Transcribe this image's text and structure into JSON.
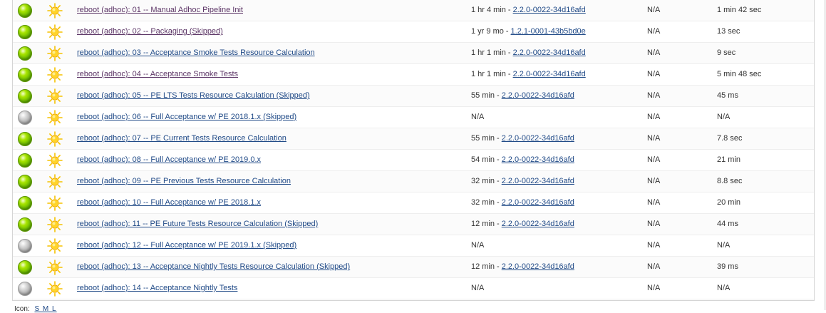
{
  "jobs": [
    {
      "status": "blue",
      "weather": "sunny-icon",
      "name": "reboot (adhoc): 01 -- Manual Adhoc Pipeline Init",
      "visited": true,
      "last_success_time": "1 hr 4 min",
      "last_success_build": "2.2.0-0022-34d16afd",
      "last_failure": "N/A",
      "last_duration": "1 min 42 sec"
    },
    {
      "status": "blue",
      "weather": "sunny-icon",
      "name": "reboot (adhoc): 02 -- Packaging (Skipped)",
      "visited": true,
      "last_success_time": "1 yr 9 mo",
      "last_success_build": "1.2.1-0001-43b5bd0e",
      "last_failure": "N/A",
      "last_duration": "13 sec"
    },
    {
      "status": "blue",
      "weather": "sunny-icon",
      "name": "reboot (adhoc): 03 -- Acceptance Smoke Tests Resource Calculation",
      "visited": false,
      "last_success_time": "1 hr 1 min",
      "last_success_build": "2.2.0-0022-34d16afd",
      "last_failure": "N/A",
      "last_duration": "9 sec"
    },
    {
      "status": "blue",
      "weather": "sunny-icon",
      "name": "reboot (adhoc): 04 -- Acceptance Smoke Tests",
      "visited": true,
      "last_success_time": "1 hr 1 min",
      "last_success_build": "2.2.0-0022-34d16afd",
      "last_failure": "N/A",
      "last_duration": "5 min 48 sec"
    },
    {
      "status": "blue",
      "weather": "sunny-icon",
      "name": "reboot (adhoc): 05 -- PE LTS Tests Resource Calculation (Skipped)",
      "visited": false,
      "last_success_time": "55 min",
      "last_success_build": "2.2.0-0022-34d16afd",
      "last_failure": "N/A",
      "last_duration": "45 ms"
    },
    {
      "status": "grey",
      "weather": "sunny-icon",
      "name": "reboot (adhoc): 06 -- Full Acceptance w/ PE 2018.1.x (Skipped)",
      "visited": false,
      "last_success_time": "N/A",
      "last_success_build": "",
      "last_failure": "N/A",
      "last_duration": "N/A"
    },
    {
      "status": "blue",
      "weather": "sunny-icon",
      "name": "reboot (adhoc): 07 -- PE Current Tests Resource Calculation",
      "visited": false,
      "last_success_time": "55 min",
      "last_success_build": "2.2.0-0022-34d16afd",
      "last_failure": "N/A",
      "last_duration": "7.8 sec"
    },
    {
      "status": "blue",
      "weather": "sunny-icon",
      "name": "reboot (adhoc): 08 -- Full Acceptance w/ PE 2019.0.x",
      "visited": false,
      "last_success_time": "54 min",
      "last_success_build": "2.2.0-0022-34d16afd",
      "last_failure": "N/A",
      "last_duration": "21 min"
    },
    {
      "status": "blue",
      "weather": "sunny-icon",
      "name": "reboot (adhoc): 09 -- PE Previous Tests Resource Calculation",
      "visited": false,
      "last_success_time": "32 min",
      "last_success_build": "2.2.0-0022-34d16afd",
      "last_failure": "N/A",
      "last_duration": "8.8 sec"
    },
    {
      "status": "blue",
      "weather": "sunny-icon",
      "name": "reboot (adhoc): 10 -- Full Acceptance w/ PE 2018.1.x",
      "visited": false,
      "last_success_time": "32 min",
      "last_success_build": "2.2.0-0022-34d16afd",
      "last_failure": "N/A",
      "last_duration": "20 min"
    },
    {
      "status": "blue",
      "weather": "sunny-icon",
      "name": "reboot (adhoc): 11 -- PE Future Tests Resource Calculation (Skipped)",
      "visited": false,
      "last_success_time": "12 min",
      "last_success_build": "2.2.0-0022-34d16afd",
      "last_failure": "N/A",
      "last_duration": "44 ms"
    },
    {
      "status": "grey",
      "weather": "sunny-icon",
      "name": "reboot (adhoc): 12 -- Full Acceptance w/ PE 2019.1.x (Skipped)",
      "visited": false,
      "last_success_time": "N/A",
      "last_success_build": "",
      "last_failure": "N/A",
      "last_duration": "N/A"
    },
    {
      "status": "blue",
      "weather": "sunny-icon",
      "name": "reboot (adhoc): 13 -- Acceptance Nightly Tests Resource Calculation (Skipped)",
      "visited": false,
      "last_success_time": "12 min",
      "last_success_build": "2.2.0-0022-34d16afd",
      "last_failure": "N/A",
      "last_duration": "39 ms"
    },
    {
      "status": "grey",
      "weather": "sunny-icon",
      "name": "reboot (adhoc): 14 -- Acceptance Nightly Tests",
      "visited": false,
      "last_success_time": "N/A",
      "last_success_build": "",
      "last_failure": "N/A",
      "last_duration": "N/A"
    }
  ],
  "legend": {
    "icon_label": "Icon:",
    "sizes": "S M L"
  },
  "colors": {
    "link": "#204a87",
    "visited_link": "#5c3566",
    "success_ball": "#7cc400",
    "disabled_ball": "#b0b0b0",
    "sun": "#f5b800"
  }
}
